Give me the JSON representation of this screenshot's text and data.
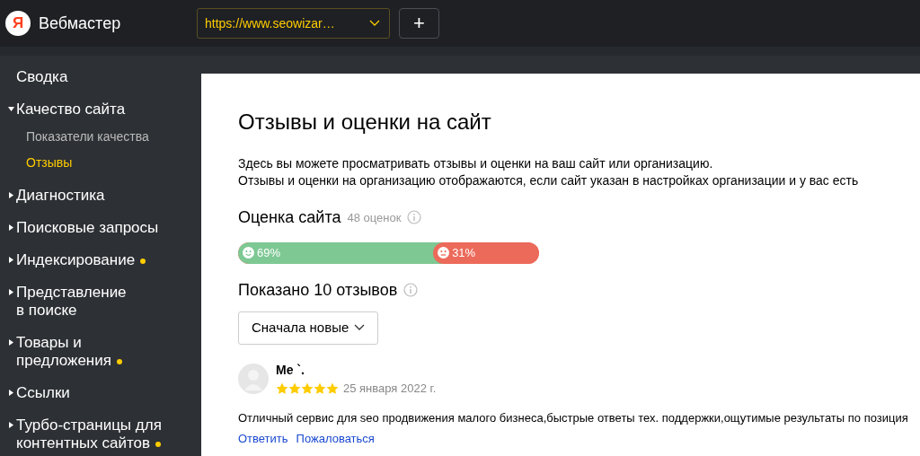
{
  "header": {
    "logo": "Я",
    "title": "Вебмастер",
    "site_select": {
      "value": "https://www.seowizar…"
    },
    "add_button": "+"
  },
  "sidebar": {
    "items": [
      {
        "label": "Сводка",
        "kind": "link"
      },
      {
        "label": "Качество сайта",
        "kind": "group",
        "expanded": true,
        "children": [
          {
            "label": "Показатели качества",
            "selected": false
          },
          {
            "label": "Отзывы",
            "selected": true
          }
        ]
      },
      {
        "label": "Диагностика",
        "kind": "group",
        "expanded": false
      },
      {
        "label": "Поисковые запросы",
        "kind": "group",
        "expanded": false
      },
      {
        "label": "Индексирование",
        "kind": "group",
        "expanded": false,
        "dot": true
      },
      {
        "label": "Представление в поиске",
        "kind": "group",
        "expanded": false
      },
      {
        "label": "Товары и предложения",
        "kind": "group",
        "expanded": false,
        "dot": true
      },
      {
        "label": "Ссылки",
        "kind": "group",
        "expanded": false
      },
      {
        "label": "Турбо-страницы для контентных сайтов",
        "kind": "group",
        "expanded": false,
        "dot": true
      }
    ]
  },
  "main": {
    "title": "Отзывы и оценки на сайт",
    "description": [
      "Здесь вы можете просматривать отзывы и оценки на ваш сайт или организацию.",
      "Отзывы и оценки на организацию отображаются, если сайт указан в настройках организации и у вас есть"
    ],
    "rating": {
      "title": "Оценка сайта",
      "count": "48 оценок",
      "positive": {
        "level": 0.69,
        "reading": "69%"
      },
      "negative": {
        "reading": "31%"
      }
    },
    "reviews_title": "Показано 10 отзывов",
    "sort": {
      "value": "Сначала новые"
    },
    "reviews": [
      {
        "author": "Me `.",
        "stars": 5,
        "date": "25 января 2022 г.",
        "text": "Отличный сервис для seo продвижения малого бизнеса,быстрые ответы тех. поддержки,ощутимые результаты по позиция",
        "actions": [
          "Ответить",
          "Пожаловаться"
        ]
      }
    ]
  }
}
